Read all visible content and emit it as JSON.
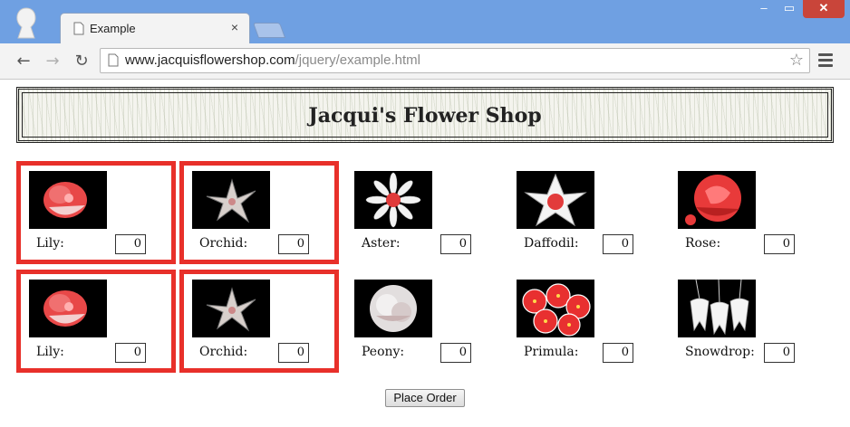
{
  "browser": {
    "tab_title": "Example",
    "tab_close": "×",
    "url_host": "www.jacquisflowershop.com",
    "url_path": "/jquery/example.html",
    "window_min": "–",
    "window_max": "▭",
    "window_close": "✕"
  },
  "page": {
    "title": "Jacqui's Flower Shop",
    "order_button": "Place Order"
  },
  "flowers": [
    {
      "name": "Lily:",
      "qty": "0",
      "highlighted": true,
      "image": "lily-icon"
    },
    {
      "name": "Orchid:",
      "qty": "0",
      "highlighted": true,
      "image": "orchid-icon"
    },
    {
      "name": "Aster:",
      "qty": "0",
      "highlighted": false,
      "image": "aster-icon"
    },
    {
      "name": "Daffodil:",
      "qty": "0",
      "highlighted": false,
      "image": "daffodil-icon"
    },
    {
      "name": "Rose:",
      "qty": "0",
      "highlighted": false,
      "image": "rose-icon"
    },
    {
      "name": "Lily:",
      "qty": "0",
      "highlighted": true,
      "image": "lily-icon"
    },
    {
      "name": "Orchid:",
      "qty": "0",
      "highlighted": true,
      "image": "orchid-icon"
    },
    {
      "name": "Peony:",
      "qty": "0",
      "highlighted": false,
      "image": "peony-icon"
    },
    {
      "name": "Primula:",
      "qty": "0",
      "highlighted": false,
      "image": "primula-icon"
    },
    {
      "name": "Snowdrop:",
      "qty": "0",
      "highlighted": false,
      "image": "snowdrop-icon"
    }
  ],
  "colors": {
    "highlight_border": "#e8302a",
    "titlebar": "#6fa0e2",
    "close_button": "#c9453a"
  }
}
